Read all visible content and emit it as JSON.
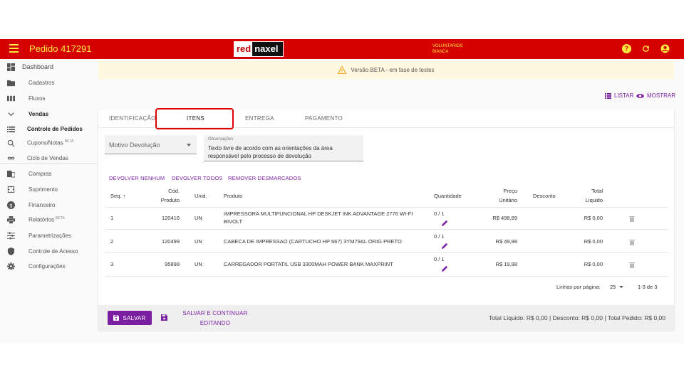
{
  "header": {
    "title": "Pedido 417291",
    "logo_red": "red",
    "logo_naxel": "naxel",
    "user_line1": "VOLUNTARIOS",
    "user_line2": "BIANCA",
    "help_glyph": "?"
  },
  "colors": {
    "brand": "#d50000",
    "accent": "#7b1fa2",
    "header_text": "#ffeb3b"
  },
  "sidebar": {
    "dashboard": "Dashboard",
    "items": [
      {
        "label": "Cadastros",
        "icon": "folder-icon"
      },
      {
        "label": "Fluxos",
        "icon": "columns-icon"
      },
      {
        "label": "Vendas",
        "icon": "chevron-down-icon"
      },
      {
        "label": "Controle de Pedidos",
        "icon": "list-icon"
      },
      {
        "label": "Cupons/Notas",
        "badge": "BETA",
        "icon": "receipt-search-icon"
      },
      {
        "label": "Ciclo de Vendas",
        "icon": "infinity-icon"
      },
      {
        "label": "Compras",
        "icon": "store-icon"
      },
      {
        "label": "Suprimento",
        "icon": "box-icon"
      },
      {
        "label": "Financeiro",
        "icon": "dollar-icon"
      },
      {
        "label": "Relatórios",
        "badge": "BETA",
        "icon": "printer-icon"
      },
      {
        "label": "Parametrizações",
        "icon": "sliders-icon"
      },
      {
        "label": "Controle de Acesso",
        "icon": "shield-icon"
      },
      {
        "label": "Configurações",
        "icon": "gear-icon"
      }
    ]
  },
  "banner": {
    "text": "Versão BETA - em fase de testes"
  },
  "view_actions": {
    "listar": "LISTAR",
    "mostrar": "MOSTRAR"
  },
  "tabs": [
    "IDENTIFICAÇÃO",
    "ITENS",
    "ENTREGA",
    "PAGAMENTO"
  ],
  "form": {
    "motivo_devolucao": "Motivo Devolução",
    "observacoes_label": "Observações",
    "observacoes_text": "Texto livre de acordo com as orientações da área responsável pelo processo de devolução"
  },
  "bulk_actions": {
    "none": "DEVOLVER NENHUM",
    "all": "DEVOLVER TODOS",
    "remove": "REMOVER DESMARCADOS"
  },
  "table": {
    "headers": {
      "seq": "Seq.",
      "cod1": "Cód.",
      "cod2": "Produto",
      "unid": "Unid.",
      "produto": "Produto",
      "quantidade": "Quantidade",
      "preco1": "Preço",
      "preco2": "Unitário",
      "desconto": "Desconto",
      "total1": "Total",
      "total2": "Líquido"
    },
    "rows": [
      {
        "seq": "1",
        "cod": "120416",
        "unid": "UN",
        "produto_l1": "IMPRESSORA MULTIFUNCIONAL HP DESKJET INK ADVANTAGE 2776 WI-FI",
        "produto_l2": "BIVOLT",
        "qtd": "0 / 1",
        "preco": "R$ 498,89",
        "total": "R$ 0,00"
      },
      {
        "seq": "2",
        "cod": "120499",
        "unid": "UN",
        "produto_l1": "CABECA DE IMPRESSAO (CARTUCHO HP 667) 3YM79AL ORIG PRETO",
        "produto_l2": "",
        "qtd": "0 / 1",
        "preco": "R$ 49,98",
        "total": "R$ 0,00"
      },
      {
        "seq": "3",
        "cod": "95898",
        "unid": "UN",
        "produto_l1": "CARREGADOR PORTATIL USB 3300MAH POWER BANK MAXPRINT",
        "produto_l2": "",
        "qtd": "0 / 1",
        "preco": "R$ 19,98",
        "total": "R$ 0,00"
      }
    ],
    "rows_per_page_label": "Linhas por página:",
    "rows_per_page": "25",
    "range": "1-3 de 3"
  },
  "footer": {
    "save": "SALVAR",
    "save_continue_l1": "SALVAR E CONTINUAR",
    "save_continue_l2": "EDITANDO",
    "totals": "Total Líquido: R$ 0,00 | Desconto: R$ 0,00 | Total Pedido: R$ 0,00"
  }
}
